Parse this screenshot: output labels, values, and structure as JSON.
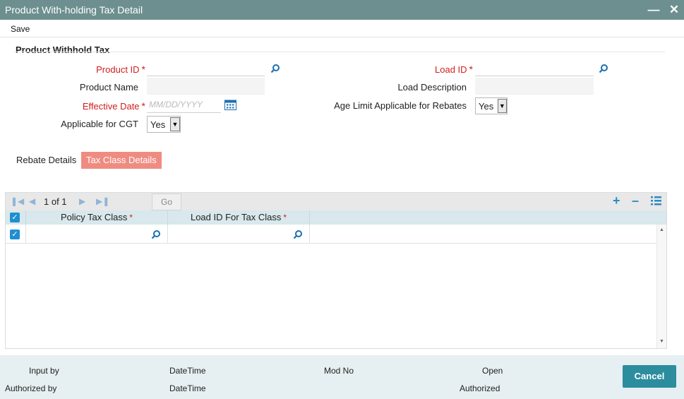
{
  "window": {
    "title": "Product With-holding Tax Detail",
    "minimize_icon": "minimize-icon",
    "close_icon": "close-icon"
  },
  "menu": {
    "save_label": "Save"
  },
  "section": {
    "title": "Product Withhold Tax"
  },
  "fields": {
    "product_id": {
      "label": "Product ID",
      "value": ""
    },
    "product_name": {
      "label": "Product Name",
      "value": ""
    },
    "effective_date": {
      "label": "Effective Date",
      "placeholder": "MM/DD/YYYY",
      "value": ""
    },
    "applicable_cgt": {
      "label": "Applicable for CGT",
      "value": "Yes"
    },
    "load_id": {
      "label": "Load ID",
      "value": ""
    },
    "load_description": {
      "label": "Load Description",
      "value": ""
    },
    "age_limit": {
      "label": "Age Limit Applicable for Rebates",
      "value": "Yes"
    }
  },
  "tabs": [
    {
      "label": "Rebate Details",
      "active": false
    },
    {
      "label": "Tax Class Details",
      "active": true
    }
  ],
  "grid": {
    "pagination": "1 of 1",
    "go_label": "Go",
    "columns": [
      "Policy Tax Class",
      "Load ID For Tax Class"
    ],
    "rows": [
      {
        "policy_tax_class": "",
        "load_id_for_tax_class": ""
      }
    ]
  },
  "footer": {
    "input_by": "Input by",
    "authorized_by": "Authorized by",
    "datetime1": "DateTime",
    "datetime2": "DateTime",
    "mod_no": "Mod No",
    "open": "Open",
    "authorized": "Authorized",
    "cancel_label": "Cancel"
  },
  "colors": {
    "titlebar": "#6d8f8f",
    "required": "#d11d1d",
    "active_tab": "#ef8c82",
    "accent": "#2c8d9e",
    "checkbox": "#1f8fd1"
  }
}
